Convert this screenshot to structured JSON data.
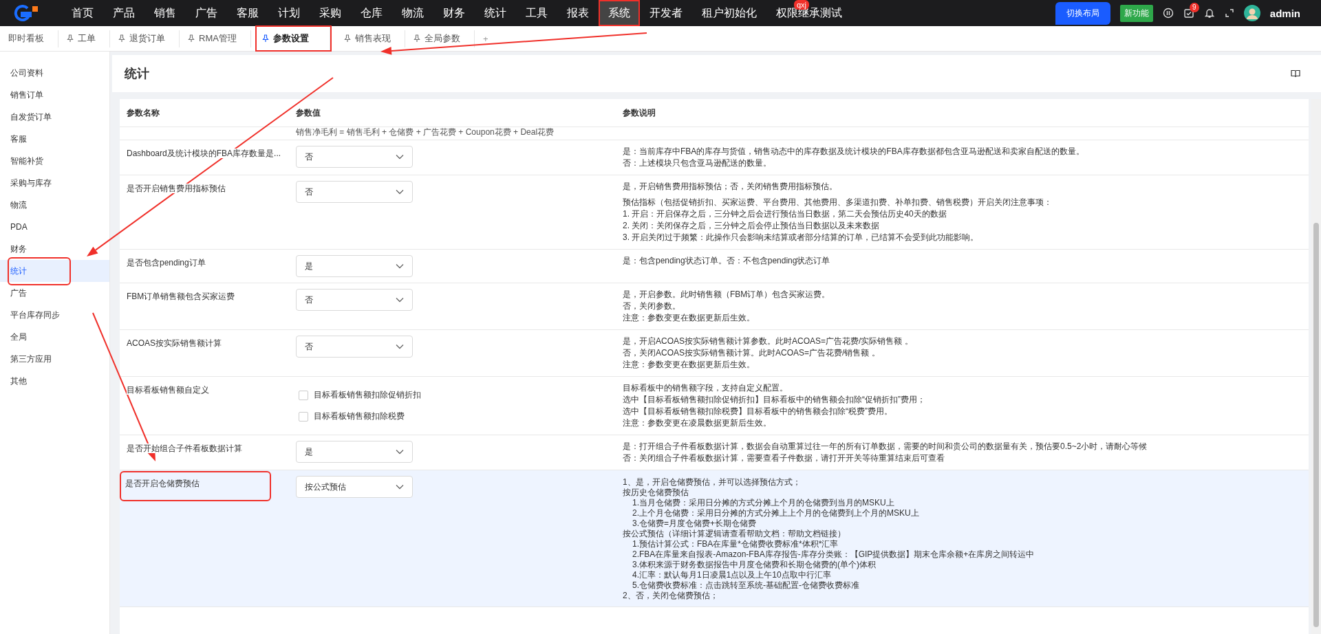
{
  "nav": {
    "items": [
      {
        "label": "首页",
        "selected": false,
        "highlighted": false
      },
      {
        "label": "产品",
        "selected": false,
        "highlighted": false
      },
      {
        "label": "销售",
        "selected": false,
        "highlighted": false
      },
      {
        "label": "广告",
        "selected": false,
        "highlighted": false
      },
      {
        "label": "客服",
        "selected": false,
        "highlighted": false
      },
      {
        "label": "计划",
        "selected": false,
        "highlighted": false
      },
      {
        "label": "采购",
        "selected": false,
        "highlighted": false
      },
      {
        "label": "仓库",
        "selected": false,
        "highlighted": false
      },
      {
        "label": "物流",
        "selected": false,
        "highlighted": false
      },
      {
        "label": "财务",
        "selected": false,
        "highlighted": false
      },
      {
        "label": "统计",
        "selected": false,
        "highlighted": false
      },
      {
        "label": "工具",
        "selected": false,
        "highlighted": false
      },
      {
        "label": "报表",
        "selected": false,
        "highlighted": false
      },
      {
        "label": "系统",
        "selected": true,
        "highlighted": true
      },
      {
        "label": "开发者",
        "selected": false,
        "highlighted": false
      },
      {
        "label": "租户初始化",
        "selected": false,
        "highlighted": false
      },
      {
        "label": "权限继承测试",
        "selected": false,
        "highlighted": false,
        "badge": "qxj"
      }
    ],
    "layout_button": "切换布局",
    "new_feature": "新功能",
    "notification_count": "9",
    "user": "admin"
  },
  "tabs": [
    {
      "label": "即时看板",
      "pinned": false,
      "selected": false,
      "highlighted": false
    },
    {
      "label": "工单",
      "pinned": true,
      "selected": false,
      "highlighted": false
    },
    {
      "label": "退货订单",
      "pinned": true,
      "selected": false,
      "highlighted": false
    },
    {
      "label": "RMA管理",
      "pinned": true,
      "selected": false,
      "highlighted": false
    },
    {
      "label": "参数设置",
      "pinned": true,
      "selected": true,
      "highlighted": true
    },
    {
      "label": "销售表现",
      "pinned": true,
      "selected": false,
      "highlighted": false
    },
    {
      "label": "全局参数",
      "pinned": true,
      "selected": false,
      "highlighted": false
    }
  ],
  "add_tab": "+",
  "sidebar": {
    "items": [
      {
        "label": "公司资料",
        "selected": false,
        "highlighted": false
      },
      {
        "label": "销售订单",
        "selected": false,
        "highlighted": false
      },
      {
        "label": "自发货订单",
        "selected": false,
        "highlighted": false
      },
      {
        "label": "客服",
        "selected": false,
        "highlighted": false
      },
      {
        "label": "智能补货",
        "selected": false,
        "highlighted": false
      },
      {
        "label": "采购与库存",
        "selected": false,
        "highlighted": false
      },
      {
        "label": "物流",
        "selected": false,
        "highlighted": false
      },
      {
        "label": "PDA",
        "selected": false,
        "highlighted": false
      },
      {
        "label": "财务",
        "selected": false,
        "highlighted": false
      },
      {
        "label": "统计",
        "selected": true,
        "highlighted": true
      },
      {
        "label": "广告",
        "selected": false,
        "highlighted": false
      },
      {
        "label": "平台库存同步",
        "selected": false,
        "highlighted": false
      },
      {
        "label": "全局",
        "selected": false,
        "highlighted": false
      },
      {
        "label": "第三方应用",
        "selected": false,
        "highlighted": false
      },
      {
        "label": "其他",
        "selected": false,
        "highlighted": false
      }
    ]
  },
  "page_title": "统计",
  "table": {
    "columns": [
      "参数名称",
      "参数值",
      "参数说明"
    ],
    "partial_row_text": "销售净毛利 = 销售毛利 + 仓储费 + 广告花费 + Coupon花费 + Deal花费",
    "rows": [
      {
        "name": "Dashboard及统计模块的FBA库存数量是...",
        "highlighted": false,
        "kind": "select",
        "value": "否",
        "description": [
          [
            {
              "text": "是：当前库存中FBA的库存与货值，销售动态中的库存数据及统计模块的FBA库存数据都包含亚马逊配送和卖家自配送的数量。"
            },
            {
              "text": "否：上述模块只包含亚马逊配送的数量。"
            }
          ]
        ]
      },
      {
        "name": "是否开启销售费用指标预估",
        "highlighted": false,
        "kind": "select",
        "value": "否",
        "description": [
          [
            {
              "text": "是，开启销售费用指标预估；否，关闭销售费用指标预估。"
            }
          ],
          [
            {
              "text": "预估指标（包括促销折扣、买家运费、平台费用、其他费用、多渠道扣费、补单扣费、销售税费）开启关闭注意事项："
            },
            {
              "text": "1. 开启：开启保存之后，三分钟之后会进行预估当日数据，第二天会预估历史40天的数据"
            },
            {
              "text": "2. 关闭：关闭保存之后，三分钟之后会停止预估当日数据以及未来数据"
            },
            {
              "text": "3. 开启关闭过于频繁：此操作只会影响未结算或者部分结算的订单，已结算不会受到此功能影响。"
            }
          ]
        ]
      },
      {
        "name": "是否包含pending订单",
        "highlighted": false,
        "kind": "select",
        "value": "是",
        "description": [
          [
            {
              "text": "是：包含pending状态订单。否：不包含pending状态订单"
            }
          ]
        ]
      },
      {
        "name": "FBM订单销售额包含买家运费",
        "highlighted": false,
        "kind": "select",
        "value": "否",
        "description": [
          [
            {
              "text": "是，开启参数。此时销售额（FBM订单）包含买家运费。"
            },
            {
              "text": "否，关闭参数。"
            },
            {
              "text": "注意：参数变更在数据更新后生效。"
            }
          ]
        ]
      },
      {
        "name": "ACOAS按实际销售额计算",
        "highlighted": false,
        "kind": "select",
        "value": "否",
        "description": [
          [
            {
              "text": "是，开启ACOAS按实际销售额计算参数。此时ACOAS=广告花费/实际销售额 。"
            },
            {
              "text": "否，关闭ACOAS按实际销售额计算。此时ACOAS=广告花费/销售额 。"
            },
            {
              "text": "注意：参数变更在数据更新后生效。"
            }
          ]
        ]
      },
      {
        "name": "目标看板销售额自定义",
        "highlighted": false,
        "kind": "checkboxes",
        "options": [
          {
            "label": "目标看板销售额扣除促销折扣",
            "checked": false
          },
          {
            "label": "目标看板销售额扣除税费",
            "checked": false
          }
        ],
        "description": [
          [
            {
              "text": "目标看板中的销售额字段，支持自定义配置。"
            },
            {
              "text": "选中【目标看板销售额扣除促销折扣】目标看板中的销售额会扣除“促销折扣”费用；"
            },
            {
              "text": "选中【目标看板销售额扣除税费】目标看板中的销售额会扣除“税费”费用。"
            },
            {
              "text": "注意：参数变更在凌晨数据更新后生效。"
            }
          ]
        ]
      },
      {
        "name": "是否开始组合子件看板数据计算",
        "highlighted": false,
        "kind": "select",
        "value": "是",
        "description": [
          [
            {
              "text": "是：打开组合子件看板数据计算，数据会自动重算过往一年的所有订单数据，需要的时间和贵公司的数据量有关，预估要0.5~2小时，请耐心等候"
            },
            {
              "text": "否：关闭组合子件看板数据计算，需要查看子件数据，请打开开关等待重算结束后可查看"
            }
          ]
        ]
      },
      {
        "name": "是否开启仓储费预估",
        "highlighted": true,
        "kind": "select",
        "value": "按公式预估",
        "description": [
          [
            {
              "text": "1、是，开启仓储费预估，并可以选择预估方式；"
            },
            {
              "text": "按历史仓储费预估",
              "children": [
                {
                  "text": "1.当月仓储费：采用日分摊的方式分摊上个月的仓储费到当月的MSKU上"
                },
                {
                  "text": "2.上个月仓储费：采用日分摊的方式分摊上上个月的仓储费到上个月的MSKU上"
                },
                {
                  "text": "3.仓储费=月度仓储费+长期仓储费"
                }
              ]
            },
            {
              "text": "按公式预估（详细计算逻辑请查看帮助文档：帮助文档链接）",
              "children": [
                {
                  "text": "1.预估计算公式：FBA在库量*仓储费收费标准*体积*汇率"
                },
                {
                  "text": "2.FBA在库量来自报表-Amazon-FBA库存报告-库存分类账：【GIP提供数据】期末仓库余额+在库房之间转运中"
                },
                {
                  "text": "3.体积来源于财务数据报告中月度仓储费和长期仓储费的(单个)体积"
                },
                {
                  "text": "4.汇率：默认每月1日凌晨1点以及上午10点取中行汇率"
                },
                {
                  "text": "5.仓储费收费标准：点击跳转至系统-基础配置-仓储费收费标准"
                }
              ]
            },
            {
              "text": "2、否，关闭仓储费预估；"
            }
          ]
        ]
      }
    ]
  }
}
